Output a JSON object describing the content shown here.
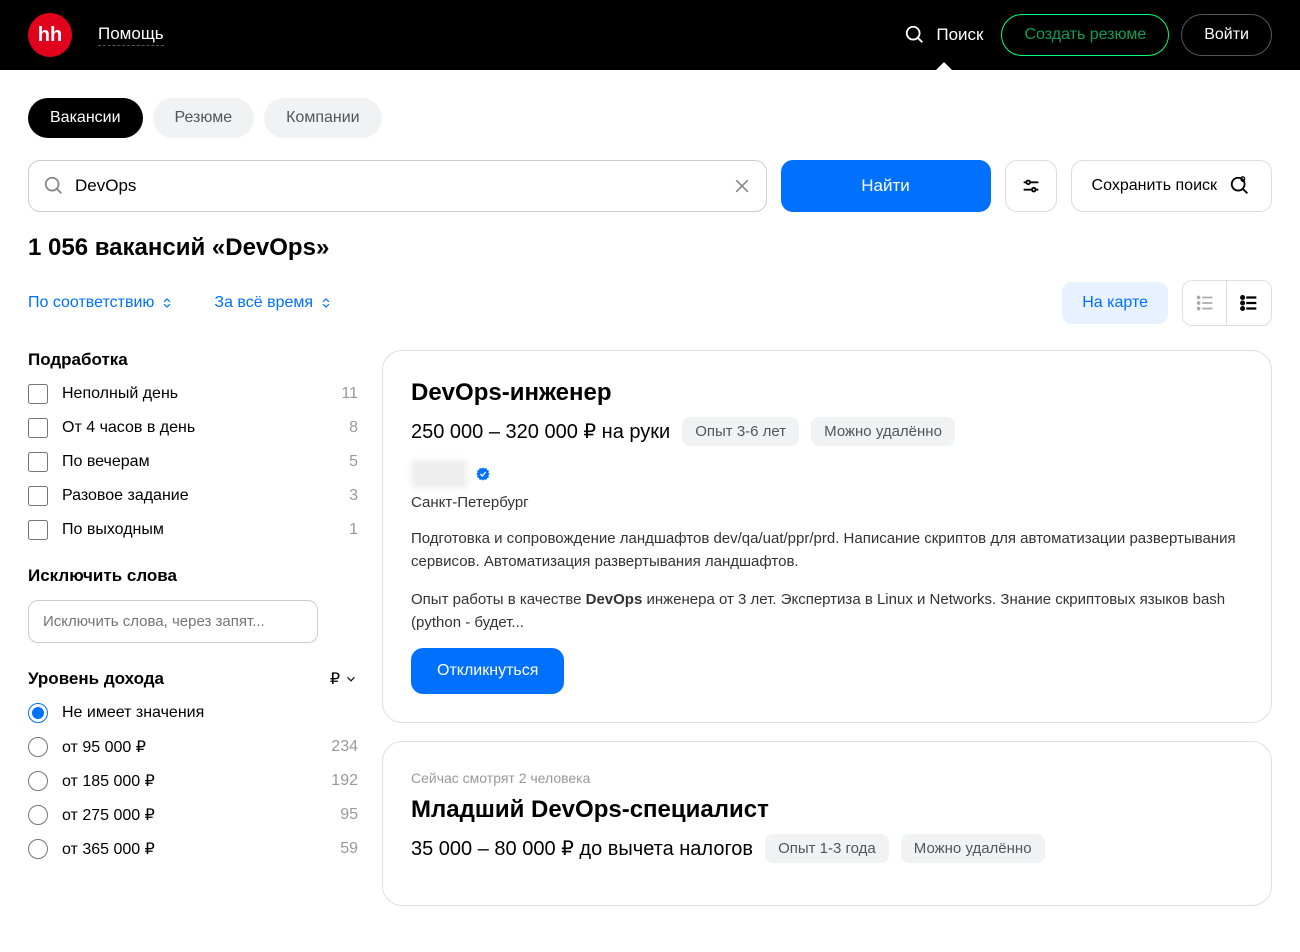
{
  "header": {
    "logo": "hh",
    "help": "Помощь",
    "search": "Поиск",
    "create_resume": "Создать резюме",
    "login": "Войти"
  },
  "tabs": {
    "vacancies": "Вакансии",
    "resumes": "Резюме",
    "companies": "Компании"
  },
  "search": {
    "value": "DevOps",
    "find": "Найти",
    "save_search": "Сохранить поиск"
  },
  "results_heading": "1 056 вакансий «DevOps»",
  "sort": {
    "relevance": "По соответствию",
    "time": "За всё время"
  },
  "map_button": "На карте",
  "sidebar": {
    "part_time": {
      "title": "Подработка",
      "items": [
        {
          "label": "Неполный день",
          "count": "11"
        },
        {
          "label": "От 4 часов в день",
          "count": "8"
        },
        {
          "label": "По вечерам",
          "count": "5"
        },
        {
          "label": "Разовое задание",
          "count": "3"
        },
        {
          "label": "По выходным",
          "count": "1"
        }
      ]
    },
    "exclude": {
      "title": "Исключить слова",
      "placeholder": "Исключить слова, через запят..."
    },
    "income": {
      "title": "Уровень дохода",
      "currency": "₽",
      "items": [
        {
          "label": "Не имеет значения",
          "count": "",
          "checked": true
        },
        {
          "label": "от 95 000 ₽",
          "count": "234"
        },
        {
          "label": "от 185 000 ₽",
          "count": "192"
        },
        {
          "label": "от 275 000 ₽",
          "count": "95"
        },
        {
          "label": "от 365 000 ₽",
          "count": "59"
        }
      ]
    }
  },
  "cards": [
    {
      "title": "DevOps-инженер",
      "salary": "250 000 – 320 000 ₽ на руки",
      "tags": [
        "Опыт 3-6 лет",
        "Можно удалённо"
      ],
      "location": "Санкт-Петербург",
      "desc1": "Подготовка и сопровождение ландшафтов dev/qa/uat/ppr/prd. Написание скриптов для автоматизации развертывания сервисов. Автоматизация развертывания ландшафтов.",
      "desc2_pre": "Опыт работы в качестве ",
      "desc2_bold": "DevOps",
      "desc2_post": " инженера от 3 лет. Экспертиза в Linux и Networks. Знание скриптовых языков bash (python - будет...",
      "apply": "Откликнуться"
    },
    {
      "watching": "Сейчас смотрят 2 человека",
      "title": "Младший DevOps-специалист",
      "salary": "35 000 – 80 000 ₽ до вычета налогов",
      "tags": [
        "Опыт 1-3 года",
        "Можно удалённо"
      ]
    }
  ]
}
